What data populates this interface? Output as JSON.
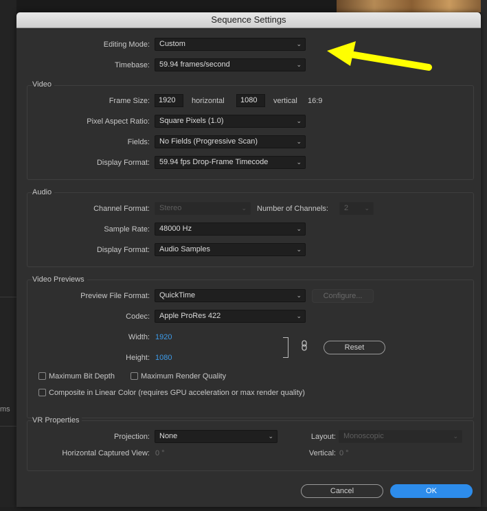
{
  "window": {
    "title": "Sequence Settings"
  },
  "background": {
    "left_text": "ms"
  },
  "general": {
    "editing_mode_label": "Editing Mode:",
    "editing_mode_value": "Custom",
    "timebase_label": "Timebase:",
    "timebase_value": "59.94  frames/second"
  },
  "video": {
    "title": "Video",
    "frame_size_label": "Frame Size:",
    "frame_width": "1920",
    "horizontal_label": "horizontal",
    "frame_height": "1080",
    "vertical_label": "vertical",
    "aspect": "16:9",
    "par_label": "Pixel Aspect Ratio:",
    "par_value": "Square Pixels (1.0)",
    "fields_label": "Fields:",
    "fields_value": "No Fields (Progressive Scan)",
    "display_format_label": "Display Format:",
    "display_format_value": "59.94 fps Drop-Frame Timecode"
  },
  "audio": {
    "title": "Audio",
    "channel_format_label": "Channel Format:",
    "channel_format_value": "Stereo",
    "num_channels_label": "Number of Channels:",
    "num_channels_value": "2",
    "sample_rate_label": "Sample Rate:",
    "sample_rate_value": "48000 Hz",
    "display_format_label": "Display Format:",
    "display_format_value": "Audio Samples"
  },
  "previews": {
    "title": "Video Previews",
    "file_format_label": "Preview File Format:",
    "file_format_value": "QuickTime",
    "configure_label": "Configure...",
    "codec_label": "Codec:",
    "codec_value": "Apple ProRes 422",
    "width_label": "Width:",
    "width_value": "1920",
    "height_label": "Height:",
    "height_value": "1080",
    "reset_label": "Reset",
    "max_bit_depth": "Maximum Bit Depth",
    "max_render_quality": "Maximum Render Quality",
    "linear_color": "Composite in Linear Color (requires GPU acceleration or max render quality)"
  },
  "vr": {
    "title": "VR Properties",
    "projection_label": "Projection:",
    "projection_value": "None",
    "layout_label": "Layout:",
    "layout_value": "Monoscopic",
    "h_view_label": "Horizontal Captured View:",
    "h_view_value": "0 °",
    "vertical_label": "Vertical:",
    "vertical_value": "0 °"
  },
  "footer": {
    "cancel_label": "Cancel",
    "ok_label": "OK"
  },
  "colors": {
    "accent": "#2d8ceb",
    "annotation_arrow": "#ffff00",
    "link_value": "#3d9be9"
  }
}
